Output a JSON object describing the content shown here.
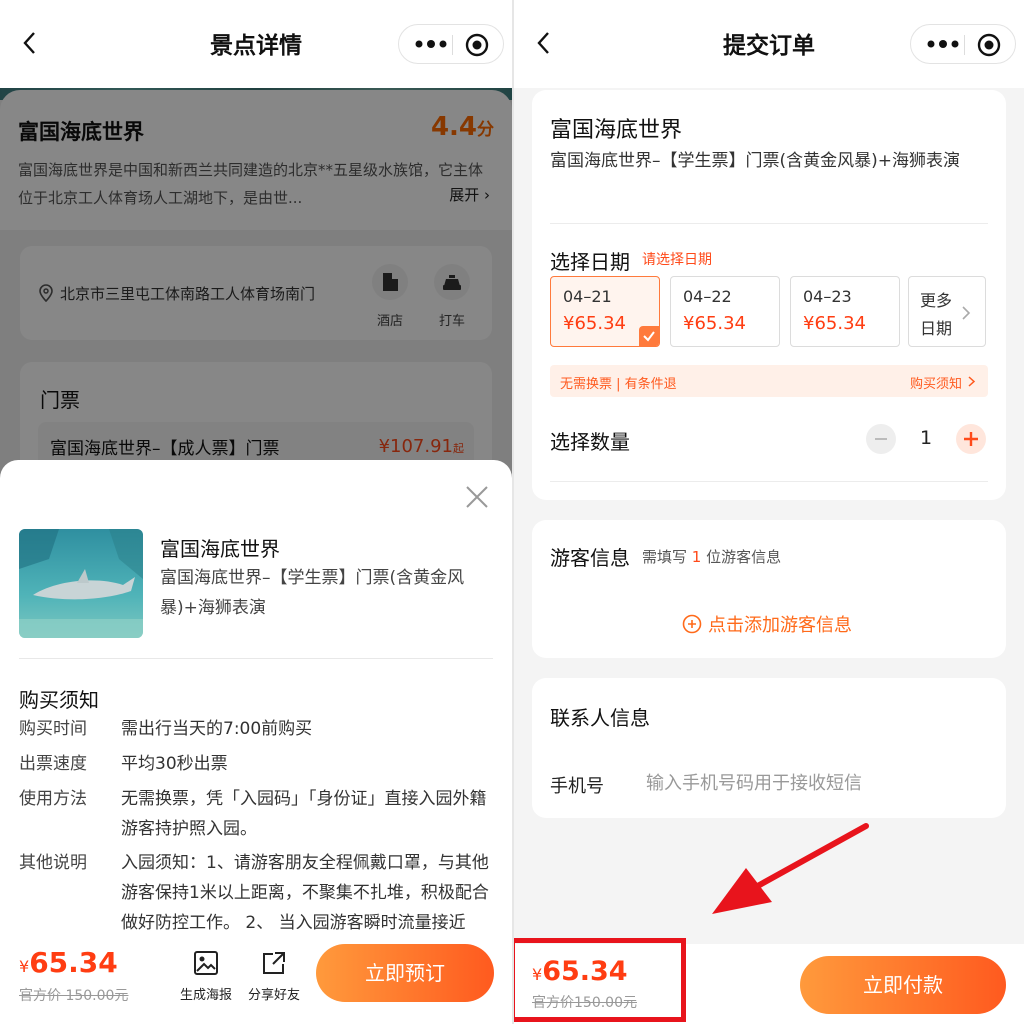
{
  "left": {
    "title": "景点详情",
    "attraction": {
      "name": "富国海底世界",
      "score": "4.4",
      "score_unit": "分",
      "description": "富国海底世界是中国和新西兰共同建造的北京**五星级水族馆，它主体位于北京工人体育场人工湖地下，是由世...",
      "expand_label": "展开"
    },
    "address": {
      "text": "北京市三里屯工体南路工人体育场南门",
      "hotel_label": "酒店",
      "taxi_label": "打车"
    },
    "tickets": {
      "heading": "门票",
      "first_name": "富国海底世界–【成人票】门票",
      "first_price": "¥107.91",
      "first_price_suffix": "起"
    },
    "sheet": {
      "name": "富国海底世界",
      "description": "富国海底世界–【学生票】门票(含黄金风暴)+海狮表演",
      "notice_title": "购买须知",
      "rows": [
        {
          "key": "购买时间",
          "value": "需出行当天的7:00前购买"
        },
        {
          "key": "出票速度",
          "value": "平均30秒出票"
        },
        {
          "key": "使用方法",
          "value": "无需换票，凭「入园码」「身份证」直接入园外籍游客持护照入园。"
        },
        {
          "key": "其他说明",
          "value": "入园须知：1、请游客朋友全程佩戴口罩，与其他游客保持1米以上距离，不聚集不扎堆，积极配合做好防控工作。 2、 当入园游客瞬时流量接近"
        }
      ]
    },
    "bottom": {
      "currency": "¥",
      "price": "65.34",
      "original_price": "官方价 150.00元",
      "poster_label": "生成海报",
      "share_label": "分享好友",
      "book_label": "立即预订"
    }
  },
  "right": {
    "title": "提交订单",
    "product": {
      "name": "富国海底世界",
      "description": "富国海底世界–【学生票】门票(含黄金风暴)+海狮表演"
    },
    "date": {
      "title": "选择日期",
      "hint": "请选择日期",
      "options": [
        {
          "date": "04–21",
          "price": "¥65.34"
        },
        {
          "date": "04–22",
          "price": "¥65.34"
        },
        {
          "date": "04–23",
          "price": "¥65.34"
        }
      ],
      "more_label": "更多日期"
    },
    "notice": {
      "left": "无需换票 | 有条件退",
      "right": "购买须知"
    },
    "quantity": {
      "title": "选择数量",
      "value": "1"
    },
    "guest": {
      "title": "游客信息",
      "hint_prefix": "需填写",
      "hint_count": "1",
      "hint_suffix": "位游客信息",
      "add_label": "点击添加游客信息"
    },
    "contact": {
      "title": "联系人信息",
      "phone_label": "手机号",
      "phone_placeholder": "输入手机号码用于接收短信"
    },
    "bottom": {
      "currency": "¥",
      "price": "65.34",
      "original_price": "官方价150.00元",
      "pay_label": "立即付款"
    }
  },
  "colors": {
    "accent": "#ff5a1f",
    "price": "#ff3d12",
    "highlight": "#e8141c"
  }
}
